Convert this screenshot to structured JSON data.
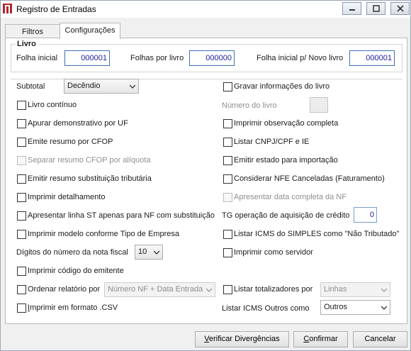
{
  "window": {
    "title": "Registro de Entradas",
    "controls": {
      "minimize": "▭",
      "maximize": "▢",
      "close": "✕"
    }
  },
  "tabs": [
    {
      "label": "Filtros",
      "active": false
    },
    {
      "label": "Configurações",
      "active": true
    }
  ],
  "livro": {
    "title": "Livro",
    "folha_inicial": {
      "label": "Folha inicial",
      "value": "000001"
    },
    "folhas_por_livro": {
      "label": "Folhas por livro",
      "value": "000000"
    },
    "folha_inicial_novo": {
      "label": "Folha inicial p/ Novo livro",
      "value": "000001"
    }
  },
  "subtotal": {
    "label": "Subtotal",
    "value": "Decêndio"
  },
  "left_options": {
    "livro_continuo": "Livro contínuo",
    "apurar_demonstrativo": "Apurar demonstrativo por UF",
    "emite_resumo_cfop": "Emite resumo por CFOP",
    "separar_resumo_cfop": "Separar resumo CFOP por alíquota",
    "emitir_resumo_st": "Emitir resumo substituição tributária",
    "imprimir_detalhamento": "Imprimir detalhamento",
    "apresentar_linha_st": "Apresentar linha ST apenas para NF com substituição",
    "imprimir_modelo": "Imprimir modelo conforme Tipo de Empresa",
    "imprimir_codigo_emitente": "Imprimir código do emitente",
    "ordenar_relatorio": "Ordenar relatório por",
    "imprimir_csv_prefix": "I",
    "imprimir_csv_rest": "mprimir em formato .CSV"
  },
  "digitos": {
    "label": "Dígitos do número da nota fiscal",
    "value": "10"
  },
  "ordenar_combo": {
    "value": "Número NF + Data Entrada"
  },
  "right_options": {
    "gravar_informacoes": "Gravar informações do livro",
    "numero_livro": "Número do livro",
    "imprimir_observacao": "Imprimir observação completa",
    "listar_cnpj": "Listar CNPJ/CPF e IE",
    "emitir_estado": "Emitir estado para importação",
    "considerar_nfe": "Considerar NFE Canceladas (Faturamento)",
    "apresentar_data": "Apresentar data completa da NF",
    "tg_operacao": "TG operação de aquisição de crédito",
    "tg_value": "0",
    "listar_icms_simples": "Listar ICMS do SIMPLES como \"Não Tributado\"",
    "imprimir_servidor": "Imprimir como servidor",
    "listar_totalizadores": "Listar totalizadores por",
    "totalizadores_value": "Linhas",
    "listar_icms_outros": "Listar ICMS Outros como",
    "icms_outros_value": "Outros"
  },
  "buttons": {
    "verificar_ul": "V",
    "verificar_rest": "erificar Divergências",
    "confirmar_ul": "C",
    "confirmar_rest": "onfirmar",
    "cancelar": "Cancelar"
  },
  "colors": {
    "accent_field": "#3c6fb4",
    "field_text": "#1c1ca0",
    "app_icon": "#b3262b"
  }
}
